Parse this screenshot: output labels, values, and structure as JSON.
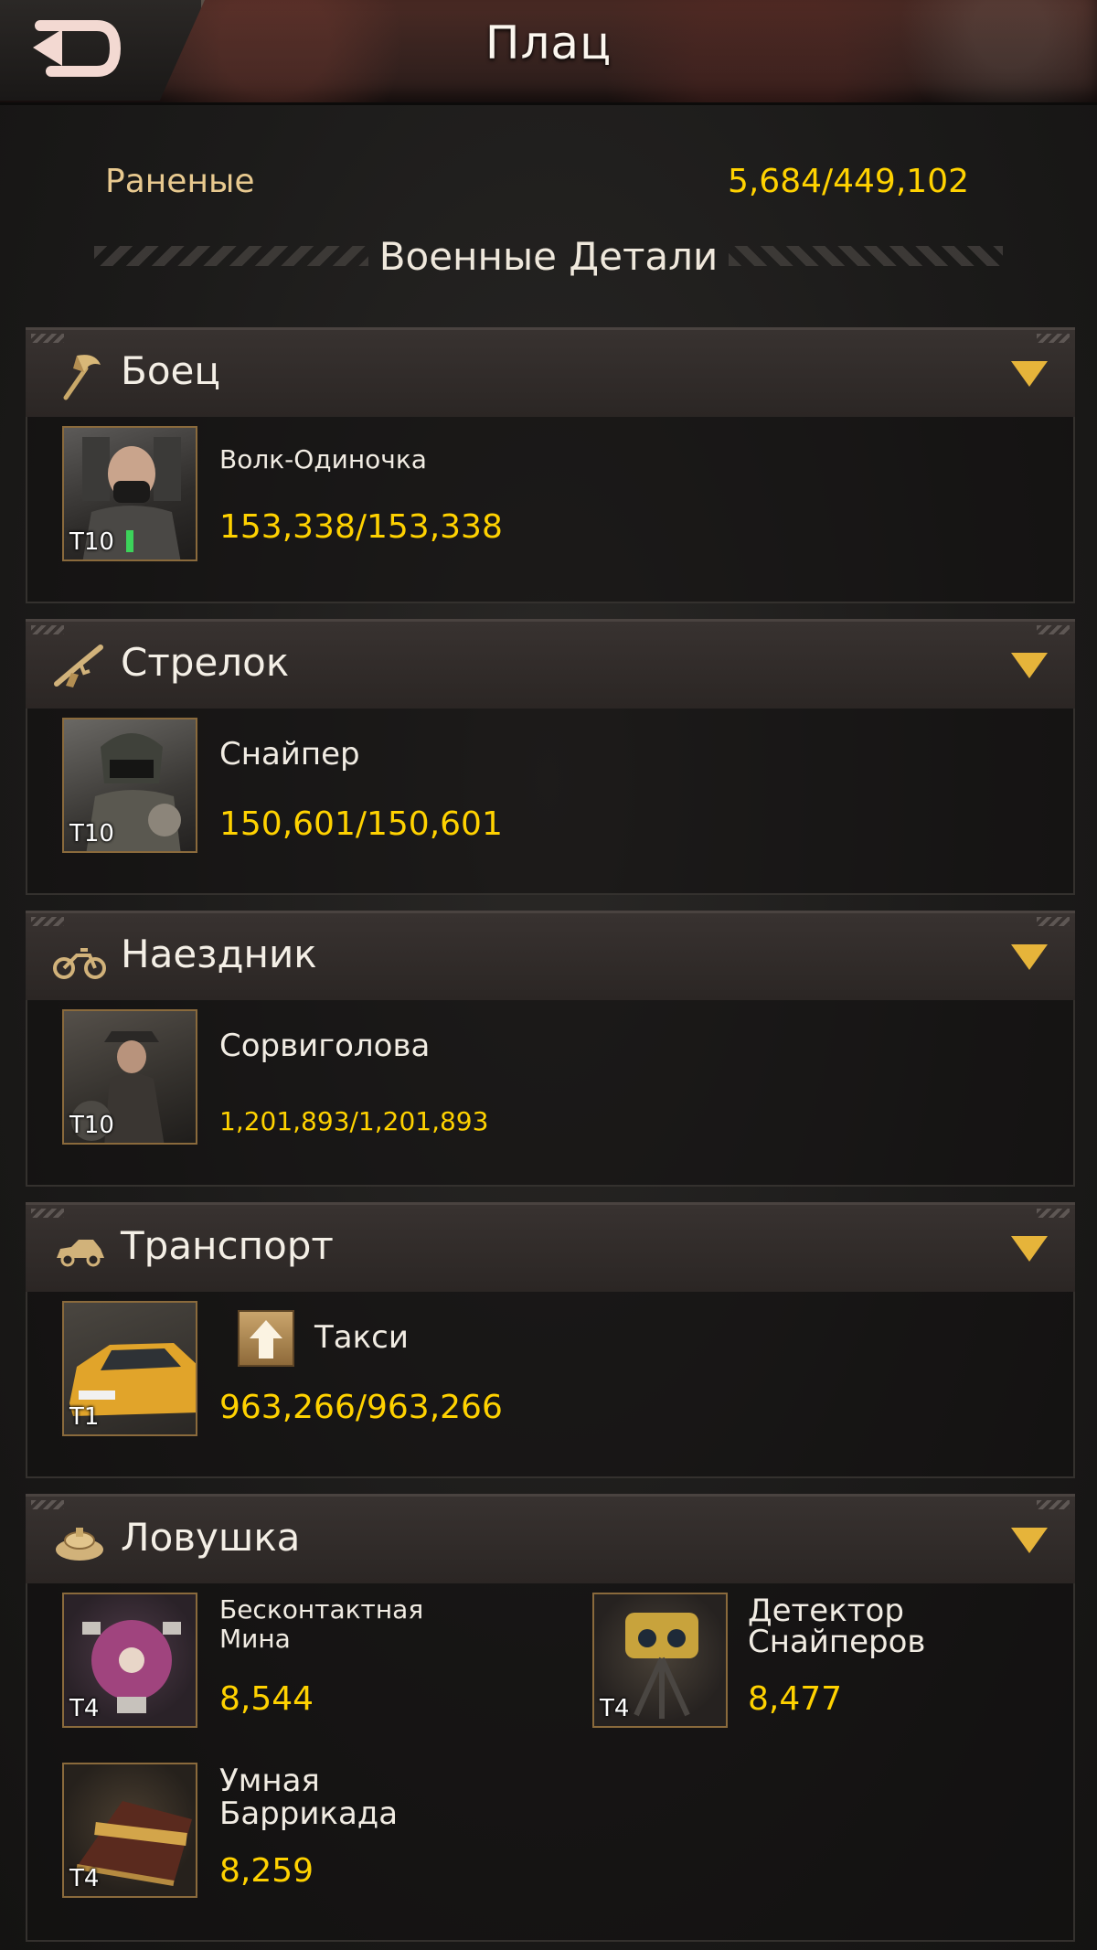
{
  "header": {
    "title": "Плац",
    "back_icon": "back-arrow-icon"
  },
  "wounded": {
    "label": "Раненые",
    "value": "5,684/449,102"
  },
  "section": {
    "title": "Военные Детали"
  },
  "categories": [
    {
      "title": "Боец",
      "icon": "axe-icon",
      "units": [
        {
          "name": "Волк-Одиночка",
          "tier": "T10",
          "count": "153,338/153,338"
        }
      ]
    },
    {
      "title": "Стрелок",
      "icon": "rifle-icon",
      "units": [
        {
          "name": "Снайпер",
          "tier": "T10",
          "count": "150,601/150,601"
        }
      ]
    },
    {
      "title": "Наездник",
      "icon": "motorcycle-icon",
      "units": [
        {
          "name": "Сорвиголова",
          "tier": "T10",
          "count": "1,201,893/1,201,893"
        }
      ]
    },
    {
      "title": "Транспорт",
      "icon": "car-icon",
      "units": [
        {
          "name": "Такси",
          "tier": "T1",
          "count": "963,266/963,266"
        }
      ]
    },
    {
      "title": "Ловушка",
      "icon": "mine-icon",
      "units": [
        {
          "name_line1": "Бесконтактная",
          "name_line2": "Мина",
          "tier": "T4",
          "count": "8,544"
        },
        {
          "name_line1": "Детектор",
          "name_line2": "Снайперов",
          "tier": "T4",
          "count": "8,477"
        },
        {
          "name_line1": "Умная",
          "name_line2": "Баррикада",
          "tier": "T4",
          "count": "8,259"
        }
      ]
    }
  ],
  "colors": {
    "gold": "#ffd200",
    "label": "#e8c98f",
    "chevron": "#e6b43a"
  }
}
